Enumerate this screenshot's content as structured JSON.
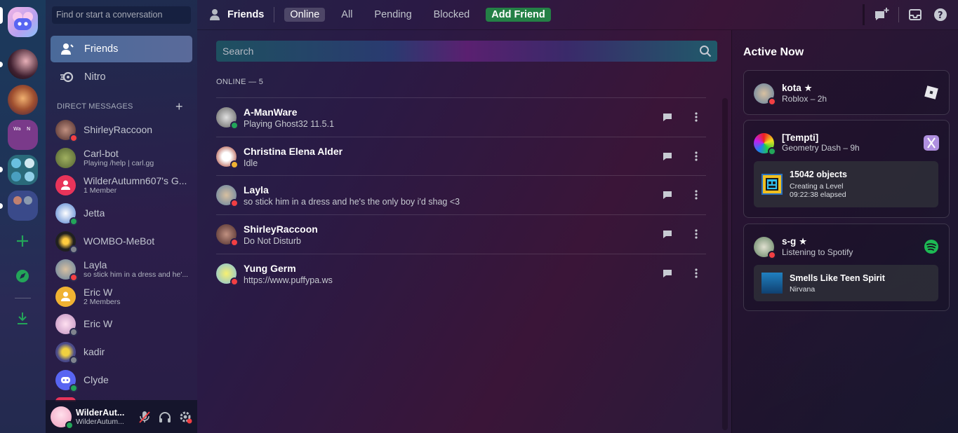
{
  "search_top": {
    "placeholder": "Find or start a conversation"
  },
  "nav": {
    "friends": "Friends",
    "nitro": "Nitro"
  },
  "dm_header": "DIRECT MESSAGES",
  "dms": [
    {
      "name": "ShirleyRaccoon",
      "sub": "",
      "status": "dnd"
    },
    {
      "name": "Carl-bot",
      "sub": "Playing /help | carl.gg",
      "status": ""
    },
    {
      "name": "WilderAutumn607's G...",
      "sub": "1 Member",
      "status": ""
    },
    {
      "name": "Jetta",
      "sub": "",
      "status": "online"
    },
    {
      "name": "WOMBO-MeBot",
      "sub": "",
      "status": "offline"
    },
    {
      "name": "Layla",
      "sub": "so stick him in a dress and he'...",
      "status": "dnd"
    },
    {
      "name": "Eric W",
      "sub": "2 Members",
      "status": ""
    },
    {
      "name": "Eric W",
      "sub": "",
      "status": "offline"
    },
    {
      "name": "kadir",
      "sub": "",
      "status": "offline"
    },
    {
      "name": "Clyde",
      "sub": "",
      "status": "online"
    }
  ],
  "user": {
    "name": "WilderAut...",
    "sub": "WilderAutum..."
  },
  "topbar": {
    "title": "Friends",
    "tabs": [
      "Online",
      "All",
      "Pending",
      "Blocked"
    ],
    "add_friend": "Add Friend"
  },
  "main_search": {
    "placeholder": "Search"
  },
  "online_header": "ONLINE — 5",
  "friends": [
    {
      "name": "A-ManWare",
      "sub": "Playing Ghost32 11.5.1",
      "status": "online"
    },
    {
      "name": "Christina Elena Alder",
      "sub": "Idle",
      "status": "idle"
    },
    {
      "name": "Layla",
      "sub": "so stick him in a dress and he's the only boy i'd shag <3",
      "status": "dnd"
    },
    {
      "name": "ShirleyRaccoon",
      "sub": "Do Not Disturb",
      "status": "dnd"
    },
    {
      "name": "Yung Germ",
      "sub": "https://www.puffypa.ws",
      "status": "dnd"
    }
  ],
  "active_now": {
    "title": "Active Now",
    "cards": [
      {
        "name": "kota ★",
        "sub": "Roblox – 2h"
      },
      {
        "name": "[Tempti]",
        "sub": "Geometry Dash – 9h",
        "inner": {
          "title": "15042 objects",
          "line1": "Creating a Level",
          "line2": "09:22:38 elapsed"
        }
      },
      {
        "name": "s-g ★",
        "sub": "Listening to Spotify",
        "inner": {
          "title": "Smells Like Teen Spirit",
          "line1": "Nirvana"
        }
      }
    ]
  },
  "colors": {
    "online": "#23a559",
    "dnd": "#f23f43",
    "idle": "#f0b232",
    "offline": "#80848e",
    "add_friend": "#248046",
    "spotify": "#1db954"
  }
}
